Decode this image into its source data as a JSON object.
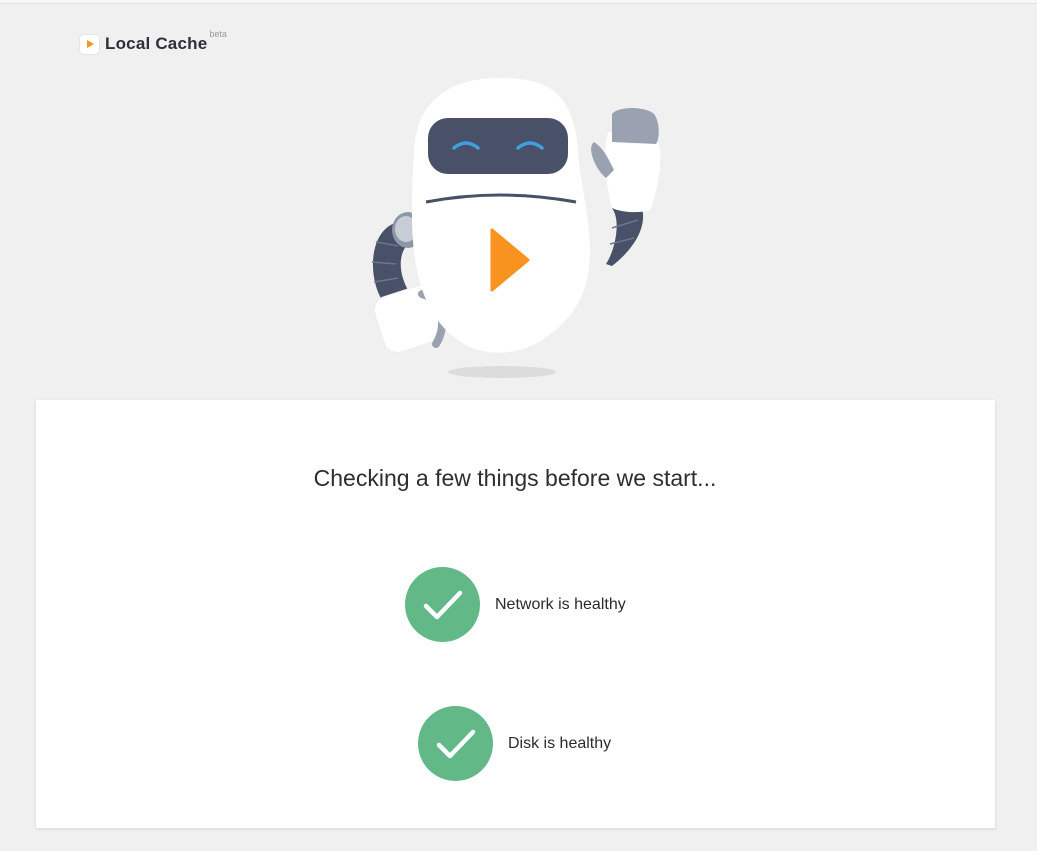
{
  "app": {
    "name": "Local Cache",
    "badge": "beta",
    "logo_icon": "play-triangle-icon",
    "accent_color": "#f7931e"
  },
  "illustration": {
    "name": "robot-mascot-waving",
    "icon": "play-triangle-icon"
  },
  "status": {
    "heading": "Checking a few things before we start...",
    "checks": [
      {
        "label": "Network is healthy",
        "state": "passed",
        "icon": "checkmark-icon",
        "color": "#62b987"
      },
      {
        "label": "Disk is healthy",
        "state": "passed",
        "icon": "checkmark-icon",
        "color": "#62b987"
      }
    ]
  }
}
